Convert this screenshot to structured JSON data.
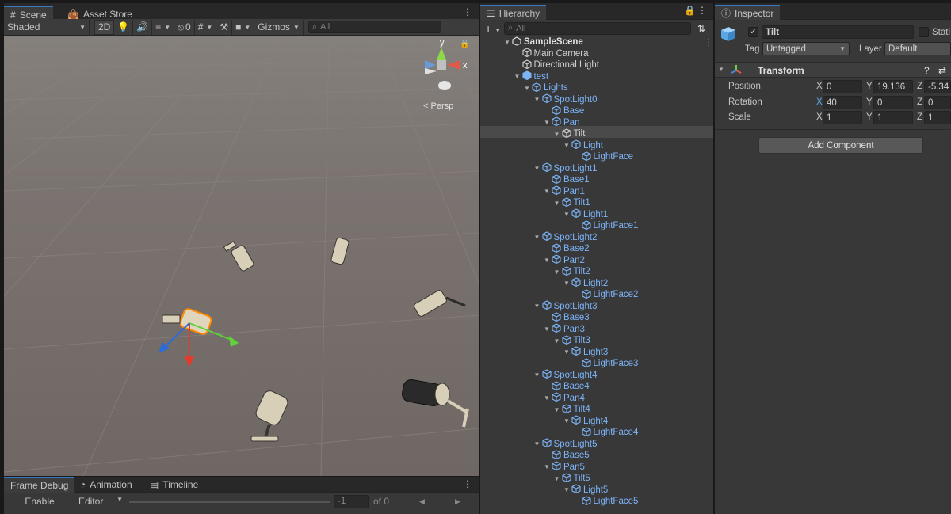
{
  "scene": {
    "tabs": [
      "Scene",
      "Asset Store"
    ],
    "shading": "Shaded",
    "mode_2d": "2D",
    "hidden_count": "0",
    "gizmos": "Gizmos",
    "search_placeholder": "All",
    "persp": "Persp",
    "gizmo_y": "y",
    "gizmo_x": "x"
  },
  "bottom": {
    "tabs": [
      "Frame Debug",
      "Animation",
      "Timeline"
    ],
    "enable": "Enable",
    "target": "Editor",
    "frame_value": "-1",
    "frame_of": "of 0"
  },
  "hierarchy": {
    "title": "Hierarchy",
    "search_placeholder": "All",
    "nodes": [
      {
        "label": "SampleScene",
        "depth": 0,
        "arrow": "down",
        "kind": "scene"
      },
      {
        "label": "Main Camera",
        "depth": 1,
        "arrow": "",
        "kind": "plain"
      },
      {
        "label": "Directional Light",
        "depth": 1,
        "arrow": "",
        "kind": "plain"
      },
      {
        "label": "test",
        "depth": 1,
        "arrow": "down",
        "kind": "blue-prefab"
      },
      {
        "label": "Lights",
        "depth": 2,
        "arrow": "down",
        "kind": "blue"
      },
      {
        "label": "SpotLight0",
        "depth": 3,
        "arrow": "down",
        "kind": "blue"
      },
      {
        "label": "Base",
        "depth": 4,
        "arrow": "",
        "kind": "blue"
      },
      {
        "label": "Pan",
        "depth": 4,
        "arrow": "down",
        "kind": "blue"
      },
      {
        "label": "Tilt",
        "depth": 5,
        "arrow": "down",
        "kind": "plain"
      },
      {
        "label": "Light",
        "depth": 6,
        "arrow": "down",
        "kind": "blue"
      },
      {
        "label": "LightFace",
        "depth": 7,
        "arrow": "",
        "kind": "blue"
      },
      {
        "label": "SpotLight1",
        "depth": 3,
        "arrow": "down",
        "kind": "blue"
      },
      {
        "label": "Base1",
        "depth": 4,
        "arrow": "",
        "kind": "blue"
      },
      {
        "label": "Pan1",
        "depth": 4,
        "arrow": "down",
        "kind": "blue"
      },
      {
        "label": "Tilt1",
        "depth": 5,
        "arrow": "down",
        "kind": "blue"
      },
      {
        "label": "Light1",
        "depth": 6,
        "arrow": "down",
        "kind": "blue"
      },
      {
        "label": "LightFace1",
        "depth": 7,
        "arrow": "",
        "kind": "blue"
      },
      {
        "label": "SpotLight2",
        "depth": 3,
        "arrow": "down",
        "kind": "blue"
      },
      {
        "label": "Base2",
        "depth": 4,
        "arrow": "",
        "kind": "blue"
      },
      {
        "label": "Pan2",
        "depth": 4,
        "arrow": "down",
        "kind": "blue"
      },
      {
        "label": "Tilt2",
        "depth": 5,
        "arrow": "down",
        "kind": "blue"
      },
      {
        "label": "Light2",
        "depth": 6,
        "arrow": "down",
        "kind": "blue"
      },
      {
        "label": "LightFace2",
        "depth": 7,
        "arrow": "",
        "kind": "blue"
      },
      {
        "label": "SpotLight3",
        "depth": 3,
        "arrow": "down",
        "kind": "blue"
      },
      {
        "label": "Base3",
        "depth": 4,
        "arrow": "",
        "kind": "blue"
      },
      {
        "label": "Pan3",
        "depth": 4,
        "arrow": "down",
        "kind": "blue"
      },
      {
        "label": "Tilt3",
        "depth": 5,
        "arrow": "down",
        "kind": "blue"
      },
      {
        "label": "Light3",
        "depth": 6,
        "arrow": "down",
        "kind": "blue"
      },
      {
        "label": "LightFace3",
        "depth": 7,
        "arrow": "",
        "kind": "blue"
      },
      {
        "label": "SpotLight4",
        "depth": 3,
        "arrow": "down",
        "kind": "blue"
      },
      {
        "label": "Base4",
        "depth": 4,
        "arrow": "",
        "kind": "blue"
      },
      {
        "label": "Pan4",
        "depth": 4,
        "arrow": "down",
        "kind": "blue"
      },
      {
        "label": "Tilt4",
        "depth": 5,
        "arrow": "down",
        "kind": "blue"
      },
      {
        "label": "Light4",
        "depth": 6,
        "arrow": "down",
        "kind": "blue"
      },
      {
        "label": "LightFace4",
        "depth": 7,
        "arrow": "",
        "kind": "blue"
      },
      {
        "label": "SpotLight5",
        "depth": 3,
        "arrow": "down",
        "kind": "blue"
      },
      {
        "label": "Base5",
        "depth": 4,
        "arrow": "",
        "kind": "blue"
      },
      {
        "label": "Pan5",
        "depth": 4,
        "arrow": "down",
        "kind": "blue"
      },
      {
        "label": "Tilt5",
        "depth": 5,
        "arrow": "down",
        "kind": "blue"
      },
      {
        "label": "Light5",
        "depth": 6,
        "arrow": "down",
        "kind": "blue"
      },
      {
        "label": "LightFace5",
        "depth": 7,
        "arrow": "",
        "kind": "blue"
      }
    ]
  },
  "inspector": {
    "title": "Inspector",
    "object_name": "Tilt",
    "static_label": "Stati",
    "tag_label": "Tag",
    "tag_value": "Untagged",
    "layer_label": "Layer",
    "layer_value": "Default",
    "transform_title": "Transform",
    "position_label": "Position",
    "rotation_label": "Rotation",
    "scale_label": "Scale",
    "axis_x": "X",
    "axis_y": "Y",
    "axis_z": "Z",
    "position": {
      "x": "0",
      "y": "19.136",
      "z": "-5.34"
    },
    "rotation": {
      "x": "40",
      "y": "0",
      "z": "0"
    },
    "scale": {
      "x": "1",
      "y": "1",
      "z": "1"
    },
    "add_component": "Add Component"
  },
  "colors": {
    "accent_blue": "#3a79bb",
    "prefab_blue": "#7cb3f7",
    "scene_bg": "#716a66"
  }
}
